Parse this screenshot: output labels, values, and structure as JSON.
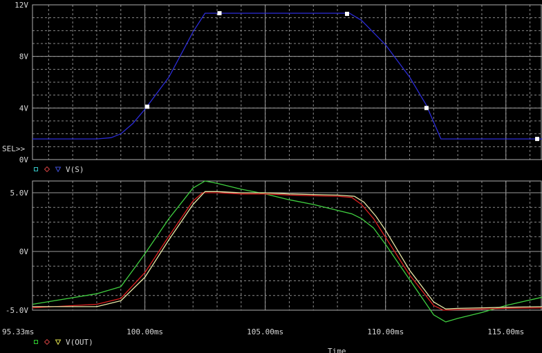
{
  "colors": {
    "background": "#000000",
    "axis_text": "#d8d8d8",
    "grid": "#9c9c9c"
  },
  "sel_label": "SEL>>",
  "x_axis": {
    "min": 95.33,
    "max": 116.5,
    "ticks": [
      100,
      105,
      110,
      115
    ],
    "tick_labels": [
      "100.00ms",
      "105.00ms",
      "110.00ms",
      "115.00ms"
    ],
    "start_label": "95.33ms",
    "label": "Time"
  },
  "chart_data": [
    {
      "type": "line",
      "ylim": [
        0,
        12
      ],
      "yticks": [
        0,
        4,
        8,
        12
      ],
      "ytick_labels": [
        "0V",
        "4V",
        "8V",
        "12V"
      ],
      "legend_text": "V(S)",
      "legend_markers": [
        {
          "symbol": "square",
          "color": "#36c8c8"
        },
        {
          "symbol": "diamond",
          "color": "#d04040"
        },
        {
          "symbol": "triangle",
          "color": "#4050d8"
        }
      ],
      "series": [
        {
          "color": "#2c2cd8",
          "x": [
            95.33,
            98.0,
            98.6,
            99.0,
            99.5,
            100.0,
            101.0,
            102.0,
            102.5,
            103.0,
            108.5,
            109.0,
            110.0,
            111.0,
            111.7,
            112.3,
            116.5
          ],
          "y": [
            1.6,
            1.6,
            1.7,
            2.0,
            2.8,
            3.9,
            6.4,
            9.9,
            11.35,
            11.35,
            11.35,
            10.8,
            8.9,
            6.4,
            4.2,
            1.6,
            1.6
          ],
          "markers": {
            "symbol": "square",
            "color": "#ffffff",
            "x": [
              100.1,
              103.1,
              108.4,
              111.7,
              116.3
            ],
            "y": [
              4.1,
              11.35,
              11.3,
              4.0,
              1.6
            ]
          }
        }
      ]
    },
    {
      "type": "line",
      "ylim": [
        -5.0,
        6.0
      ],
      "yticks": [
        -5.0,
        0,
        5.0
      ],
      "ytick_labels": [
        "-5.0V",
        "0V",
        "5.0V"
      ],
      "legend_text": "V(OUT)",
      "legend_markers": [
        {
          "symbol": "square",
          "color": "#30d030"
        },
        {
          "symbol": "diamond",
          "color": "#d04040"
        },
        {
          "symbol": "triangle",
          "color": "#e8e850"
        }
      ],
      "series": [
        {
          "color": "#40d040",
          "x": [
            95.33,
            98.0,
            99.0,
            100.0,
            101.0,
            102.0,
            102.5,
            103.0,
            104.0,
            105.0,
            106.0,
            107.0,
            108.0,
            108.6,
            109.0,
            109.5,
            110.0,
            111.0,
            112.0,
            112.5,
            113.0,
            114.0,
            115.0,
            116.5
          ],
          "y": [
            -4.5,
            -3.6,
            -3.0,
            -0.2,
            2.8,
            5.4,
            6.0,
            5.8,
            5.3,
            4.9,
            4.4,
            4.0,
            3.5,
            3.2,
            2.8,
            2.0,
            0.6,
            -2.4,
            -5.4,
            -6.0,
            -5.7,
            -5.2,
            -4.6,
            -3.9
          ]
        },
        {
          "color": "#e02020",
          "x": [
            95.33,
            98.0,
            99.0,
            100.0,
            101.0,
            102.0,
            102.4,
            103.0,
            104.0,
            105.0,
            106.0,
            107.0,
            108.0,
            108.6,
            109.0,
            109.5,
            110.0,
            111.0,
            112.0,
            112.4,
            113.0,
            114.0,
            115.0,
            116.5
          ],
          "y": [
            -4.8,
            -4.5,
            -4.0,
            -1.8,
            1.3,
            4.3,
            5.0,
            5.0,
            4.9,
            4.9,
            4.8,
            4.75,
            4.7,
            4.6,
            4.0,
            2.8,
            1.2,
            -2.0,
            -4.6,
            -5.0,
            -4.95,
            -4.9,
            -4.85,
            -4.8
          ]
        },
        {
          "color": "#e8e8a8",
          "x": [
            95.33,
            98.0,
            99.0,
            100.0,
            101.0,
            102.0,
            102.5,
            103.0,
            104.0,
            105.0,
            106.0,
            107.0,
            108.0,
            108.7,
            109.1,
            109.6,
            110.0,
            111.0,
            112.0,
            112.5,
            113.0,
            114.0,
            115.0,
            116.5
          ],
          "y": [
            -4.7,
            -4.7,
            -4.2,
            -2.2,
            1.0,
            4.0,
            5.1,
            5.1,
            5.0,
            5.0,
            4.9,
            4.85,
            4.8,
            4.7,
            4.2,
            3.0,
            1.8,
            -1.6,
            -4.3,
            -4.9,
            -4.85,
            -4.8,
            -4.75,
            -4.7
          ]
        }
      ]
    }
  ]
}
